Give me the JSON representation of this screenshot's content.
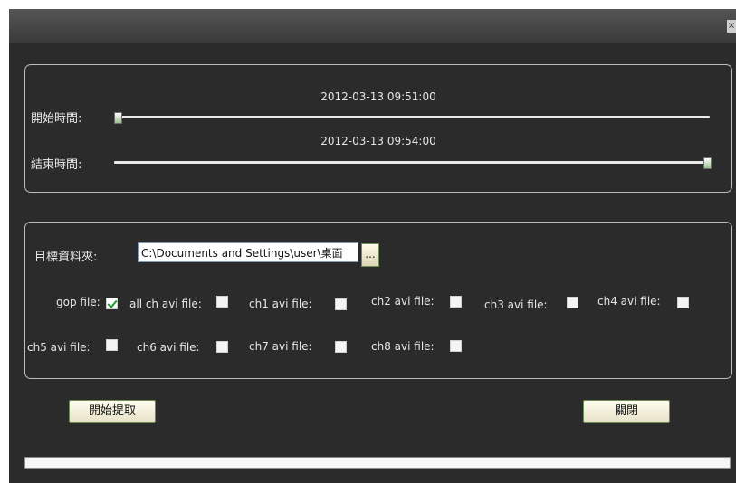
{
  "window": {
    "close_label": "×"
  },
  "time_range": {
    "start_label": "開始時間:",
    "start_time": "2012-03-13 09:51:00",
    "start_slider_position": 0.0,
    "end_label": "結束時間:",
    "end_time": "2012-03-13 09:54:00",
    "end_slider_position": 1.0
  },
  "export": {
    "dest_folder_label": "目標資料夾:",
    "dest_folder_value": "C:\\Documents and Settings\\user\\桌面",
    "browse_label": "...",
    "options": [
      {
        "label": "gop file:",
        "checked": true
      },
      {
        "label": "all ch avi file:",
        "checked": false
      },
      {
        "label": "ch1 avi file:",
        "checked": false
      },
      {
        "label": "ch2 avi file:",
        "checked": false
      },
      {
        "label": "ch3 avi file:",
        "checked": false
      },
      {
        "label": "ch4 avi file:",
        "checked": false
      },
      {
        "label": "ch5 avi file:",
        "checked": false
      },
      {
        "label": "ch6 avi file:",
        "checked": false
      },
      {
        "label": "ch7 avi file:",
        "checked": false
      },
      {
        "label": "ch8 avi file:",
        "checked": false
      }
    ]
  },
  "buttons": {
    "start_extract": "開始提取",
    "close": "關閉"
  },
  "progress": {
    "value": 0
  },
  "colors": {
    "dialog_bg": "#2b2b2b",
    "check_green": "#1b9a2c",
    "button_face": "#f3eed6"
  }
}
